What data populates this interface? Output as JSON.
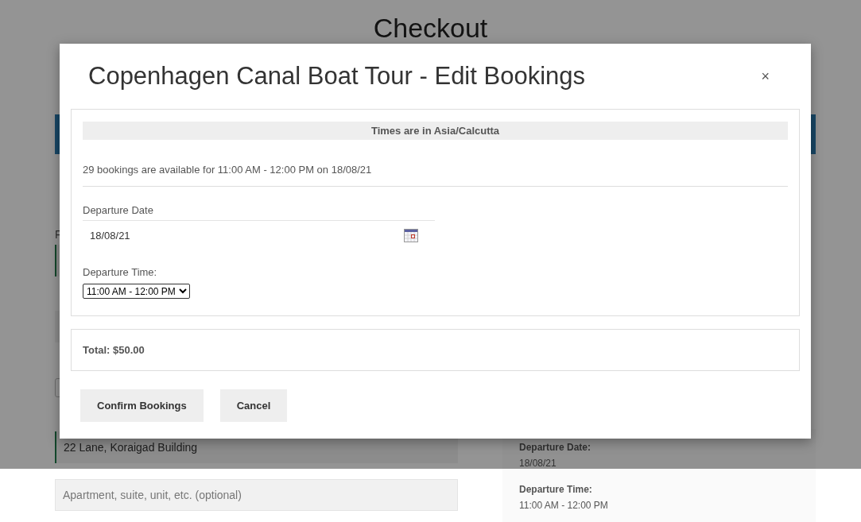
{
  "page": {
    "title": "Checkout",
    "form": {
      "fields": [
        {
          "label": "F",
          "kind": "highlighted"
        },
        {
          "kind": "shaded"
        },
        {
          "kind": "outlined"
        },
        {
          "kind": "highlighted",
          "value": "22 Lane, Koraigad Building"
        },
        {
          "kind": "shaded",
          "placeholder": "Apartment, suite, unit, etc. (optional)"
        }
      ]
    },
    "summary": [
      {
        "label": "Departure Date:",
        "value": "18/08/21"
      },
      {
        "label": "Departure Time:",
        "value": "11:00 AM - 12:00 PM"
      }
    ]
  },
  "modal": {
    "title": "Copenhagen Canal Boat Tour - Edit Bookings",
    "close": "×",
    "timezone": "Times are in Asia/Calcutta",
    "availability": "29 bookings are available for 11:00 AM - 12:00 PM on 18/08/21",
    "date_label": "Departure Date",
    "date_value": "18/08/21",
    "time_label": "Departure Time:",
    "time_value": "11:00 AM - 12:00 PM",
    "total": "Total: $50.00",
    "buttons": [
      "Confirm Bookings",
      "Cancel"
    ]
  }
}
